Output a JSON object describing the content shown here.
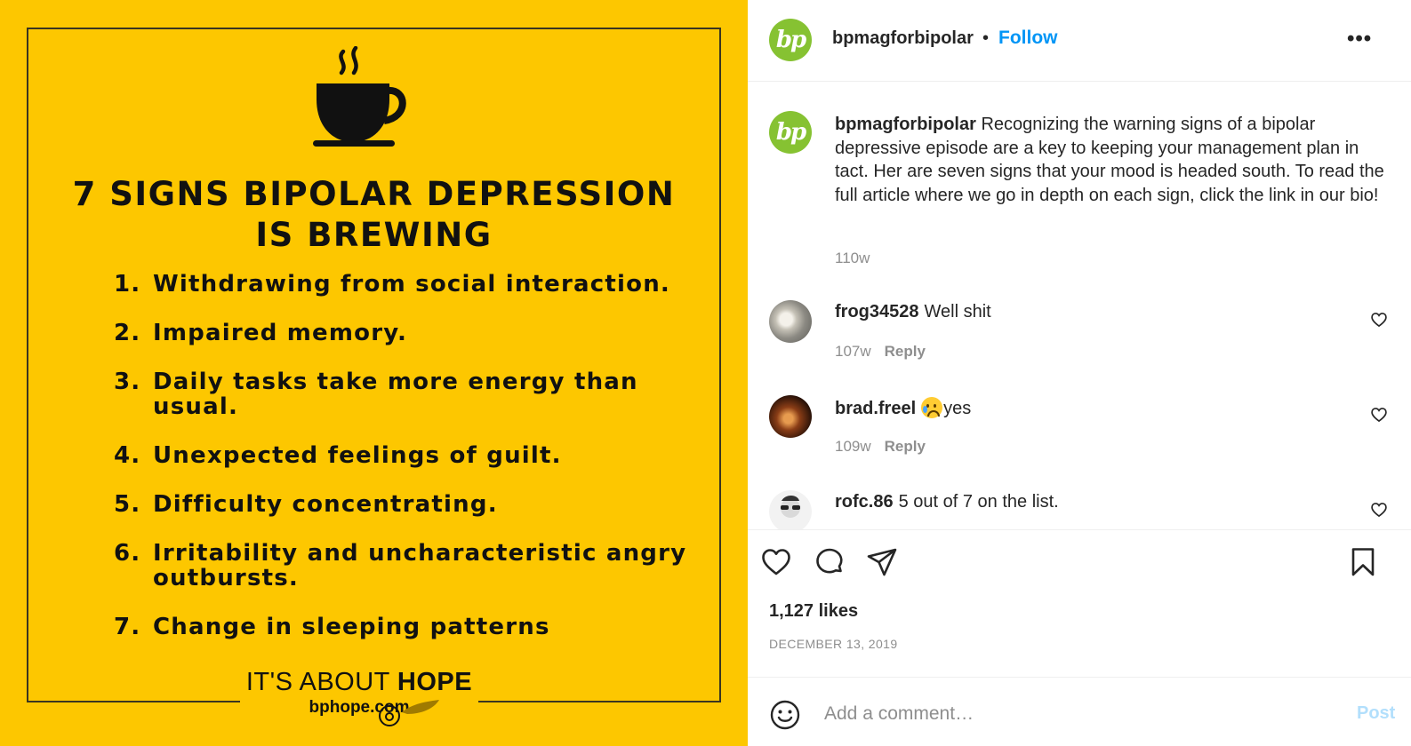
{
  "poster": {
    "title_line1": "7 SIGNS BIPOLAR DEPRESSION",
    "title_line2": "IS BREWING",
    "items": [
      {
        "num": "1.",
        "text": "Withdrawing from social interaction."
      },
      {
        "num": "2.",
        "text": "Impaired memory."
      },
      {
        "num": "3.",
        "text": "Daily tasks take more energy than usual."
      },
      {
        "num": "4.",
        "text": "Unexpected feelings of guilt."
      },
      {
        "num": "5.",
        "text": "Difficulty concentrating."
      },
      {
        "num": "6.",
        "text": "Irritability and uncharacteristic angry outbursts."
      },
      {
        "num": "7.",
        "text": "Change in sleeping patterns"
      }
    ],
    "tagline_prefix": "IT'S ABOUT ",
    "tagline_bold": "HOPE",
    "url": "bphope.com",
    "background_color": "#fdc700"
  },
  "header": {
    "avatar_text": "bp",
    "username": "bpmagforbipolar",
    "separator": "•",
    "follow_label": "Follow",
    "more_label": "•••"
  },
  "caption": {
    "avatar_text": "bp",
    "username": "bpmagforbipolar",
    "text": "Recognizing the warning signs of a bipolar depressive episode are a key to keeping your management plan in tact. Her are seven signs that your mood is headed south. To read the full article where we go in depth on each sign, click the link in our bio!",
    "time": "110w"
  },
  "comments": [
    {
      "username": "frog34528",
      "text": "Well shit",
      "time": "107w",
      "reply_label": "Reply"
    },
    {
      "username": "brad.freel",
      "emoji": "crying-face",
      "text": "yes",
      "time": "109w",
      "reply_label": "Reply"
    },
    {
      "username": "rofc.86",
      "text": "5 out of 7 on the list.",
      "time": "",
      "reply_label": ""
    }
  ],
  "footer": {
    "likes": "1,127 likes",
    "date": "DECEMBER 13, 2019",
    "comment_placeholder": "Add a comment…",
    "post_label": "Post"
  },
  "colors": {
    "brand_green": "#86c232",
    "link_blue": "#0095f6",
    "post_disabled": "#b2dffc"
  }
}
